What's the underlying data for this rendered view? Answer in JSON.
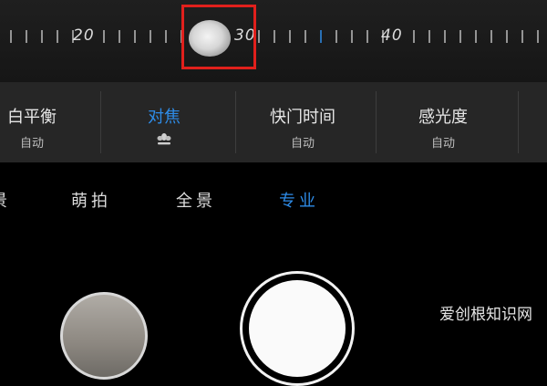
{
  "focus_ruler": {
    "labels": [
      "20",
      "30",
      "40"
    ],
    "current_value": 27
  },
  "settings": {
    "items": [
      {
        "label": "白平衡",
        "value": "自动"
      },
      {
        "label": "对焦",
        "value": "",
        "icon": "flower-macro-icon"
      },
      {
        "label": "快门时间",
        "value": "自动"
      },
      {
        "label": "感光度",
        "value": "自动"
      }
    ]
  },
  "modes": {
    "items": [
      "景",
      "萌拍",
      "全景",
      "专业"
    ],
    "active": "专业"
  },
  "watermark": "爱创根知识网",
  "colors": {
    "accent": "#2e8ce8",
    "highlight_box": "#e0201c",
    "panel": "#262626"
  }
}
